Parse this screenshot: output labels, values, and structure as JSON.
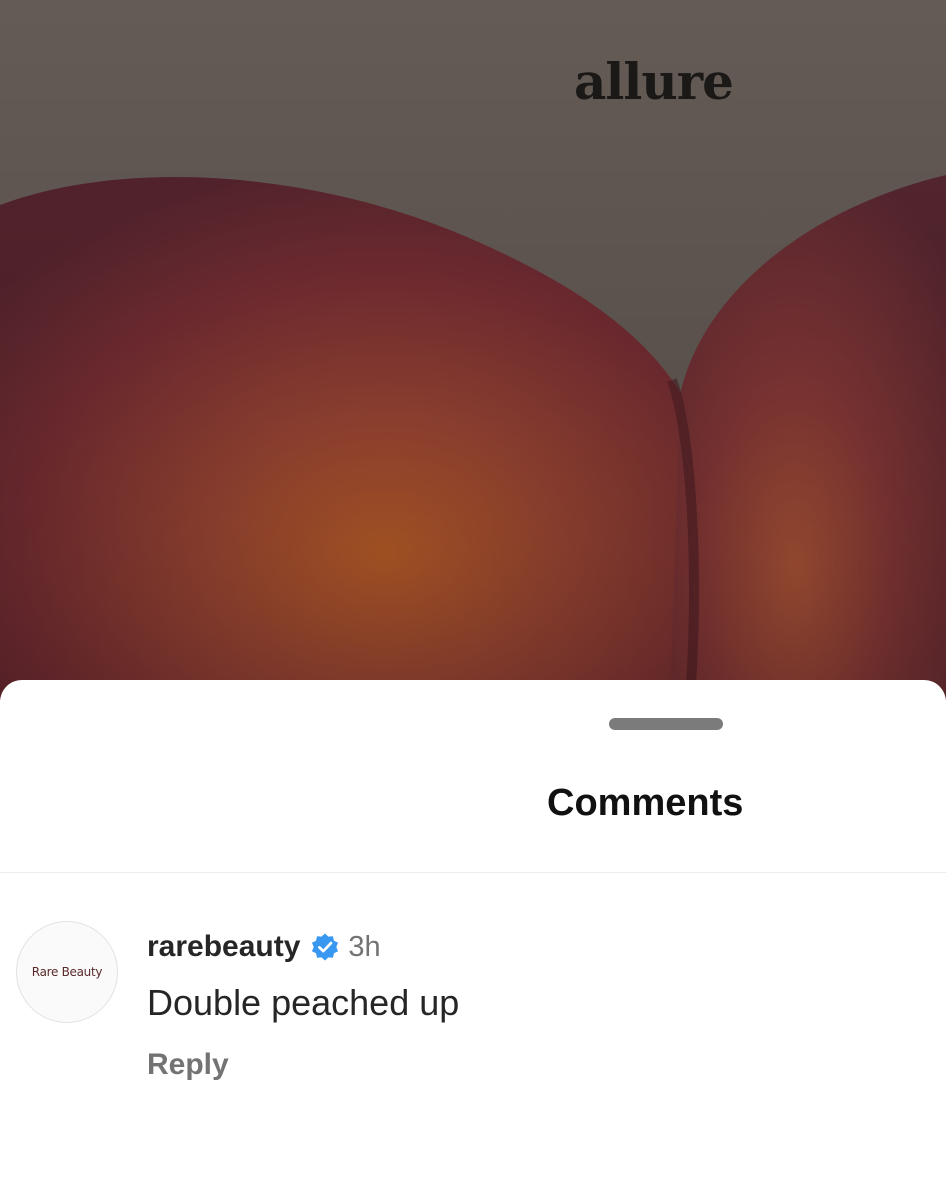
{
  "post": {
    "brand_logo": "allure",
    "image": "peach-closeup"
  },
  "sheet": {
    "title": "Comments"
  },
  "comment": {
    "avatar_text": "Rare Beauty",
    "username": "rarebeauty",
    "verified_icon": "verified-badge-icon",
    "time": "3h",
    "text": "Double peached up",
    "reply_label": "Reply"
  },
  "colors": {
    "background_photo": "#6a605a",
    "verified_blue": "#3897f0",
    "text_primary": "#262626",
    "text_secondary": "#737373"
  }
}
